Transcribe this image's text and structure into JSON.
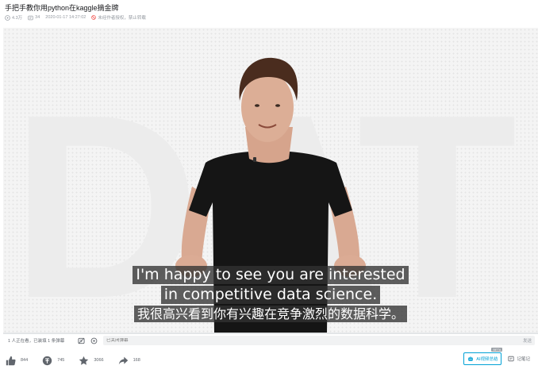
{
  "video": {
    "title": "手把手教你用python在kaggle摘金牌",
    "plays": "4.3万",
    "danmaku": "34",
    "date": "2020-01-17 14:27:02",
    "rights": "未经作者授权，禁止转载"
  },
  "player": {
    "background_text": "DAT",
    "subtitle_en_line1": "I'm happy to see you are interested",
    "subtitle_en_line2": "in competitive data science.",
    "subtitle_cn": "我很高兴看到你有兴趣在竞争激烈的数据科学。",
    "progress_fraction": 0
  },
  "danmaku_bar": {
    "viewer_count": "1 人正在看，已装填 1 条弹幕",
    "input_placeholder": "已关闭弹幕",
    "send_label": "发送"
  },
  "actions": {
    "like_count": "844",
    "coin_count": "745",
    "fav_count": "3066",
    "share_count": "168",
    "ai_label": "AI视频总结",
    "ai_tag": "BETA",
    "note_label": "记笔记"
  },
  "colors": {
    "accent": "#00a1d6",
    "muted": "#9499a0",
    "subtitle_bg": "#323232"
  }
}
